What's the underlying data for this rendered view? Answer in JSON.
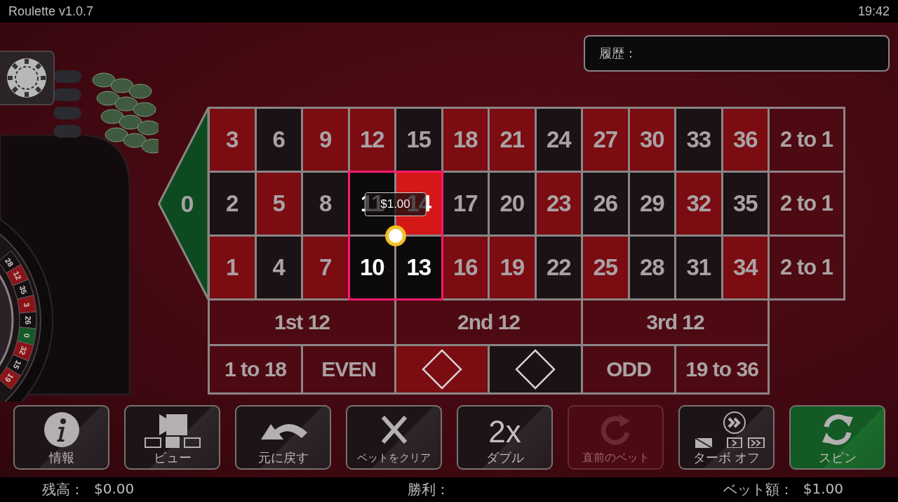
{
  "title_bar": {
    "title": "Roulette v1.0.7",
    "time": "19:42"
  },
  "history": {
    "label": "履歴："
  },
  "wheel_pockets": [
    {
      "label": "28",
      "kind": "black"
    },
    {
      "label": "12",
      "kind": "red"
    },
    {
      "label": "35",
      "kind": "black"
    },
    {
      "label": "3",
      "kind": "red"
    },
    {
      "label": "26",
      "kind": "black"
    },
    {
      "label": "0",
      "kind": "green"
    },
    {
      "label": "32",
      "kind": "red"
    },
    {
      "label": "15",
      "kind": "black"
    },
    {
      "label": "19",
      "kind": "red"
    }
  ],
  "table": {
    "zero": {
      "label": "0",
      "selected": false
    },
    "rows": [
      [
        {
          "label": "3",
          "kind": "red",
          "selected": false
        },
        {
          "label": "6",
          "kind": "black",
          "selected": false
        },
        {
          "label": "9",
          "kind": "red",
          "selected": false
        },
        {
          "label": "12",
          "kind": "red",
          "selected": false
        },
        {
          "label": "15",
          "kind": "black",
          "selected": false
        },
        {
          "label": "18",
          "kind": "red",
          "selected": false
        },
        {
          "label": "21",
          "kind": "red",
          "selected": false
        },
        {
          "label": "24",
          "kind": "black",
          "selected": false
        },
        {
          "label": "27",
          "kind": "red",
          "selected": false
        },
        {
          "label": "30",
          "kind": "red",
          "selected": false
        },
        {
          "label": "33",
          "kind": "black",
          "selected": false
        },
        {
          "label": "36",
          "kind": "red",
          "selected": false
        }
      ],
      [
        {
          "label": "2",
          "kind": "black",
          "selected": false
        },
        {
          "label": "5",
          "kind": "red",
          "selected": false
        },
        {
          "label": "8",
          "kind": "black",
          "selected": false
        },
        {
          "label": "11",
          "kind": "black",
          "selected": true
        },
        {
          "label": "14",
          "kind": "red",
          "selected": true
        },
        {
          "label": "17",
          "kind": "black",
          "selected": false
        },
        {
          "label": "20",
          "kind": "black",
          "selected": false
        },
        {
          "label": "23",
          "kind": "red",
          "selected": false
        },
        {
          "label": "26",
          "kind": "black",
          "selected": false
        },
        {
          "label": "29",
          "kind": "black",
          "selected": false
        },
        {
          "label": "32",
          "kind": "red",
          "selected": false
        },
        {
          "label": "35",
          "kind": "black",
          "selected": false
        }
      ],
      [
        {
          "label": "1",
          "kind": "red",
          "selected": false
        },
        {
          "label": "4",
          "kind": "black",
          "selected": false
        },
        {
          "label": "7",
          "kind": "red",
          "selected": false
        },
        {
          "label": "10",
          "kind": "black",
          "selected": true
        },
        {
          "label": "13",
          "kind": "black",
          "selected": true
        },
        {
          "label": "16",
          "kind": "red",
          "selected": false
        },
        {
          "label": "19",
          "kind": "red",
          "selected": false
        },
        {
          "label": "22",
          "kind": "black",
          "selected": false
        },
        {
          "label": "25",
          "kind": "red",
          "selected": false
        },
        {
          "label": "28",
          "kind": "black",
          "selected": false
        },
        {
          "label": "31",
          "kind": "black",
          "selected": false
        },
        {
          "label": "34",
          "kind": "red",
          "selected": false
        }
      ]
    ],
    "column_bets": [
      {
        "label": "2 to 1",
        "selected": false
      },
      {
        "label": "2 to 1",
        "selected": false
      },
      {
        "label": "2 to 1",
        "selected": false
      }
    ],
    "dozens": [
      {
        "label": "1st 12",
        "selected": false
      },
      {
        "label": "2nd 12",
        "selected": false
      },
      {
        "label": "3rd 12",
        "selected": false
      }
    ],
    "even_money": [
      {
        "kind": "text",
        "label": "1 to 18",
        "selected": false
      },
      {
        "kind": "text",
        "label": "EVEN",
        "selected": false
      },
      {
        "kind": "red-diamond",
        "selected": false
      },
      {
        "kind": "black-diamond",
        "selected": false
      },
      {
        "kind": "text",
        "label": "ODD",
        "selected": false
      },
      {
        "kind": "text",
        "label": "19 to 36",
        "selected": false
      }
    ]
  },
  "bet": {
    "amount": "$1.00"
  },
  "buttons": [
    {
      "label": "情報",
      "kind": "info",
      "disabled": false,
      "primary": false
    },
    {
      "label": "ビュー",
      "kind": "view",
      "disabled": false,
      "primary": false
    },
    {
      "label": "元に戻す",
      "kind": "undo",
      "disabled": false,
      "primary": false
    },
    {
      "label": "ベットをクリア",
      "kind": "clear",
      "disabled": false,
      "primary": false
    },
    {
      "label": "ダブル",
      "kind": "double",
      "icon_text": "2x",
      "disabled": false,
      "primary": false
    },
    {
      "label": "直前のベット",
      "kind": "rebet",
      "disabled": true,
      "primary": false
    },
    {
      "label": "ターボ オフ",
      "kind": "turbo",
      "disabled": false,
      "primary": false
    },
    {
      "label": "スピン",
      "kind": "spin",
      "disabled": false,
      "primary": true
    }
  ],
  "status_bar": {
    "balance_label": "残高：",
    "balance": "$0.00",
    "win_label": "勝利：",
    "bet_label": "ベット額：",
    "bet": "$1.00"
  }
}
